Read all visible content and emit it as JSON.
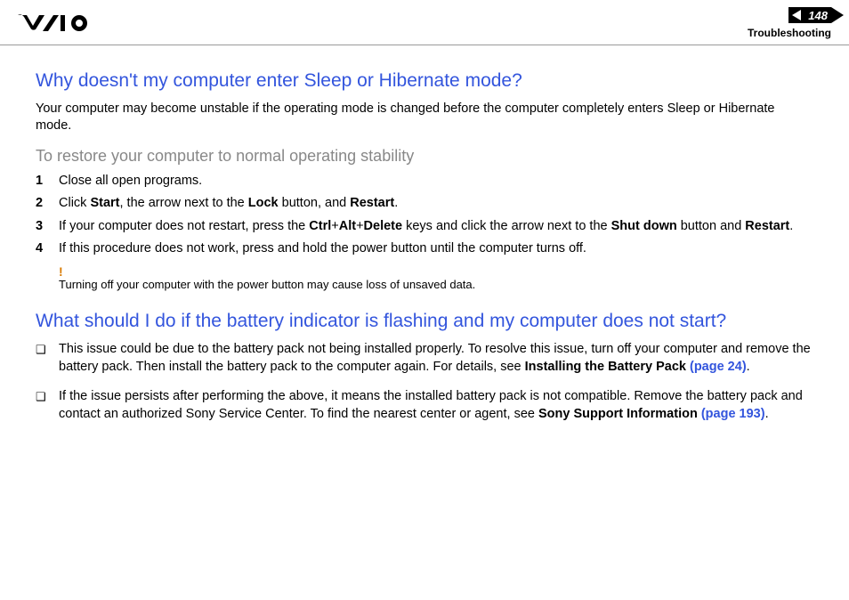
{
  "header": {
    "page_number": "148",
    "section": "Troubleshooting"
  },
  "q1": {
    "title": "Why doesn't my computer enter Sleep or Hibernate mode?",
    "intro": "Your computer may become unstable if the operating mode is changed before the computer completely enters Sleep or Hibernate mode.",
    "subhead": "To restore your computer to normal operating stability",
    "steps": {
      "s1": "Close all open programs.",
      "s2_a": "Click ",
      "s2_b1": "Start",
      "s2_c": ", the arrow next to the ",
      "s2_b2": "Lock",
      "s2_d": " button, and ",
      "s2_b3": "Restart",
      "s2_e": ".",
      "s3_a": "If your computer does not restart, press the ",
      "s3_b1": "Ctrl",
      "s3_p1": "+",
      "s3_b2": "Alt",
      "s3_p2": "+",
      "s3_b3": "Delete",
      "s3_c": " keys and click the arrow next to the ",
      "s3_b4": "Shut down",
      "s3_d": " button and ",
      "s3_b5": "Restart",
      "s3_e": ".",
      "s4": "If this procedure does not work, press and hold the power button until the computer turns off."
    },
    "warning_mark": "!",
    "warning": "Turning off your computer with the power button may cause loss of unsaved data."
  },
  "q2": {
    "title": "What should I do if the battery indicator is flashing and my computer does not start?",
    "b1_a": "This issue could be due to the battery pack not being installed properly. To resolve this issue, turn off your computer and remove the battery pack. Then install the battery pack to the computer again. For details, see ",
    "b1_bold": "Installing the Battery Pack ",
    "b1_link": "(page 24)",
    "b1_end": ".",
    "b2_a": "If the issue persists after performing the above, it means the installed battery pack is not compatible. Remove the battery pack and contact an authorized Sony Service Center. To find the nearest center or agent, see ",
    "b2_bold": "Sony Support Information ",
    "b2_link": "(page 193)",
    "b2_end": "."
  }
}
